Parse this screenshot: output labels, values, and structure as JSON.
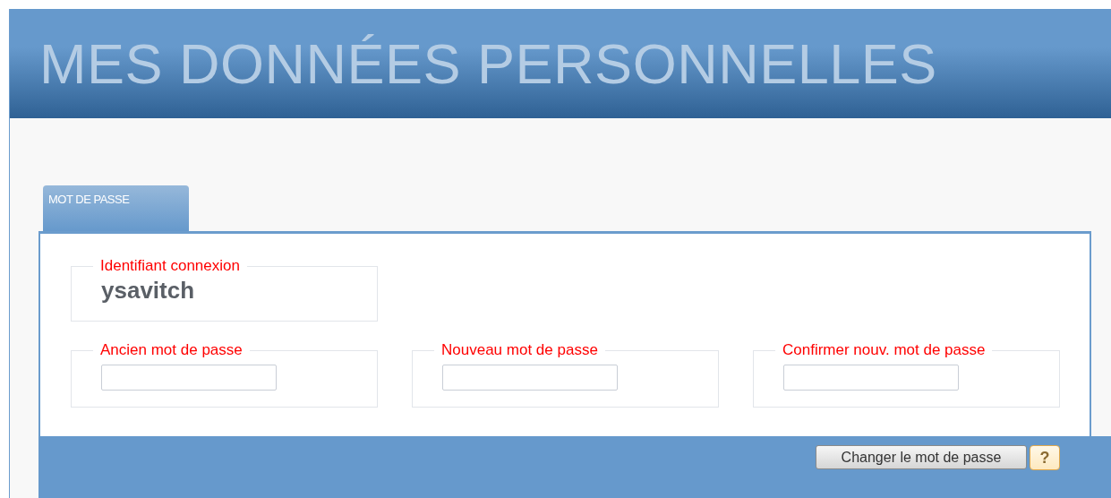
{
  "header": {
    "title": "MES DONNÉES PERSONNELLES"
  },
  "tabs": [
    {
      "label": "MOT DE PASSE",
      "selected": true
    }
  ],
  "login": {
    "legend": "Identifiant connexion",
    "value": "ysavitch"
  },
  "password_fields": [
    {
      "legend": "Ancien mot de passe"
    },
    {
      "legend": "Nouveau mot de passe"
    },
    {
      "legend": "Confirmer nouv. mot de passe"
    }
  ],
  "footer": {
    "submit_button": "Changer le mot de passe",
    "help_button": "?"
  }
}
